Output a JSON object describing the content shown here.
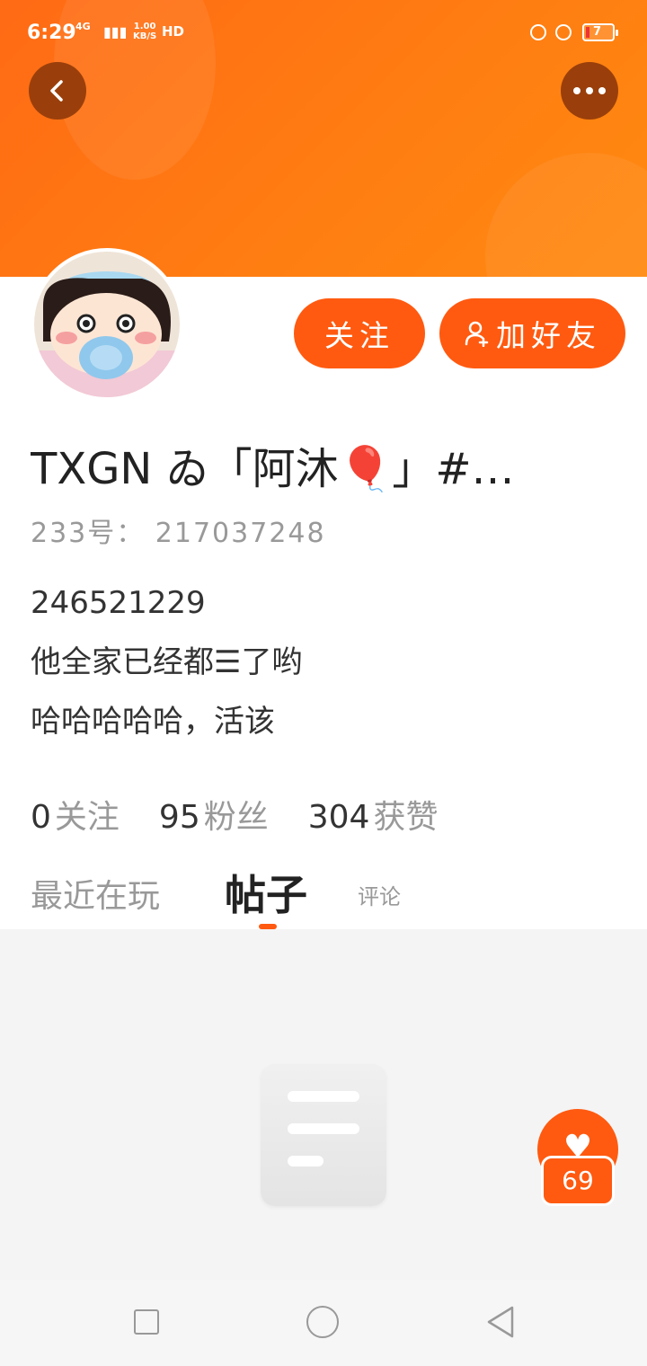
{
  "status_bar": {
    "time": "6:29",
    "network": "4G",
    "speed_value": "1.00",
    "speed_unit": "KB/S",
    "hd": "HD",
    "battery": "7"
  },
  "header": {
    "back_icon": "chevron-left-icon",
    "more_icon": "more-horizontal-icon"
  },
  "actions": {
    "follow_label": "关注",
    "add_friend_label": "加好友",
    "add_friend_icon": "person-add-icon"
  },
  "profile": {
    "name": "TXGN ゐ「阿沐🎈」#…",
    "uid": "233号： 217037248",
    "bio": [
      "246521229",
      "他全家已经都☰了哟",
      "哈哈哈哈哈，活该"
    ]
  },
  "stats": [
    {
      "num": "0",
      "label": "关注"
    },
    {
      "num": "95",
      "label": "粉丝"
    },
    {
      "num": "304",
      "label": "获赞"
    }
  ],
  "tabs": {
    "recent": "最近在玩",
    "posts": "帖子",
    "comments": "评论",
    "active": "posts"
  },
  "fab": {
    "icon": "heart-icon",
    "count": "69"
  },
  "colors": {
    "accent": "#ff5a10",
    "header_gradient_start": "#ff6a14",
    "header_gradient_end": "#ff8a10"
  }
}
